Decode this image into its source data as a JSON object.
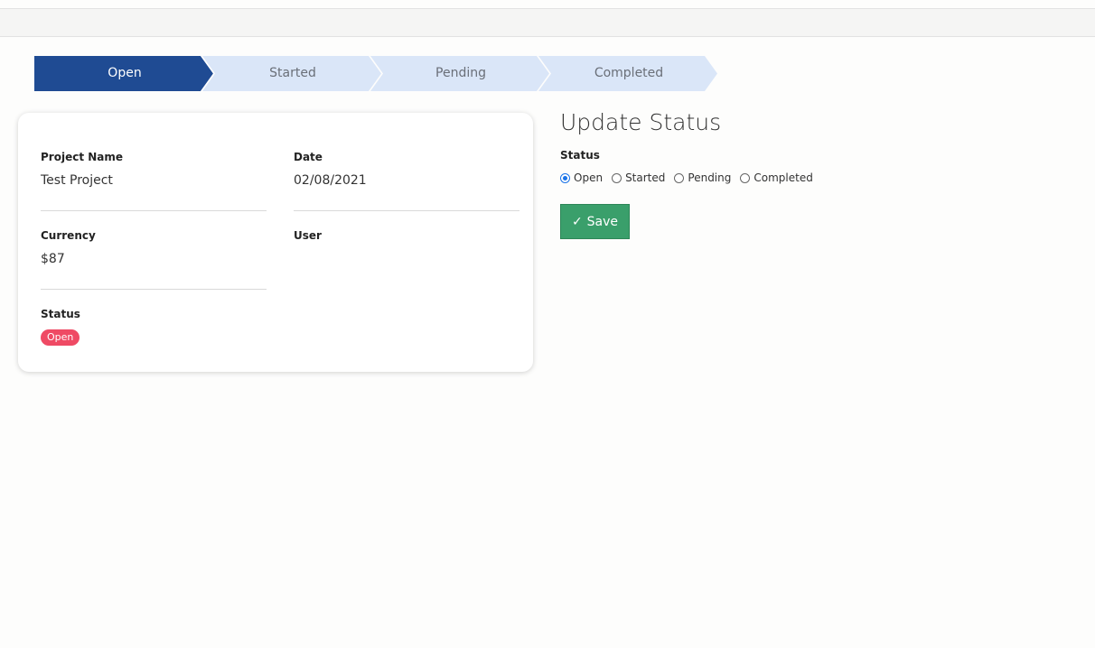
{
  "stepper": {
    "steps": [
      {
        "label": "Open",
        "active": true
      },
      {
        "label": "Started",
        "active": false
      },
      {
        "label": "Pending",
        "active": false
      },
      {
        "label": "Completed",
        "active": false
      }
    ],
    "active_color": "#1f4b93",
    "inactive_color": "#dae6f8"
  },
  "details": {
    "project_name_label": "Project Name",
    "project_name_value": "Test Project",
    "date_label": "Date",
    "date_value": "02/08/2021",
    "currency_label": "Currency",
    "currency_value": "$87",
    "user_label": "User",
    "user_value": "",
    "status_label": "Status",
    "status_value": "Open"
  },
  "update": {
    "title": "Update Status",
    "status_label": "Status",
    "options": [
      {
        "label": "Open",
        "checked": true
      },
      {
        "label": "Started",
        "checked": false
      },
      {
        "label": "Pending",
        "checked": false
      },
      {
        "label": "Completed",
        "checked": false
      }
    ],
    "save_label": "Save",
    "save_icon": "check-icon"
  }
}
